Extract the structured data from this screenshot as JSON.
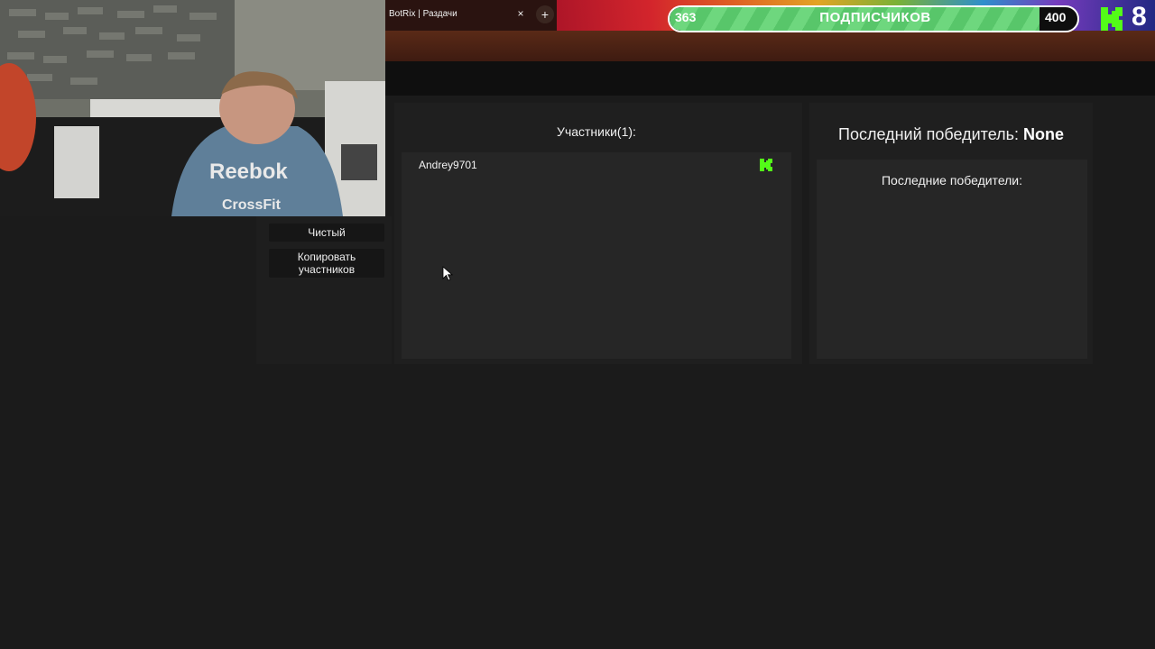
{
  "browser": {
    "tab_title": "BotRix | Раздачи",
    "tab_close_label": "×",
    "new_tab_label": "+"
  },
  "subscriber_goal": {
    "current": "363",
    "label": "ПОДПИСЧИКОВ",
    "goal": "400",
    "progress_fraction": 0.9075,
    "followers_count": "8",
    "accent_color": "#58c66a"
  },
  "webcam": {
    "shirt_text_1": "Reebok",
    "shirt_text_2": "CrossFit"
  },
  "left_panel": {
    "clear_label": "Чистый",
    "copy_label_line1": "Копировать",
    "copy_label_line2": "участников"
  },
  "participants": {
    "title": "Участники(1):",
    "items": [
      {
        "name": "Andrey9701",
        "platform_icon": "kick-icon"
      }
    ]
  },
  "winner": {
    "label": "Последний победитель: ",
    "value": "None",
    "recent_title": "Последние победители:"
  },
  "colors": {
    "background": "#1b1b1b",
    "panel": "#1f1f1f",
    "list": "#262626",
    "kick_green": "#53fc18"
  }
}
